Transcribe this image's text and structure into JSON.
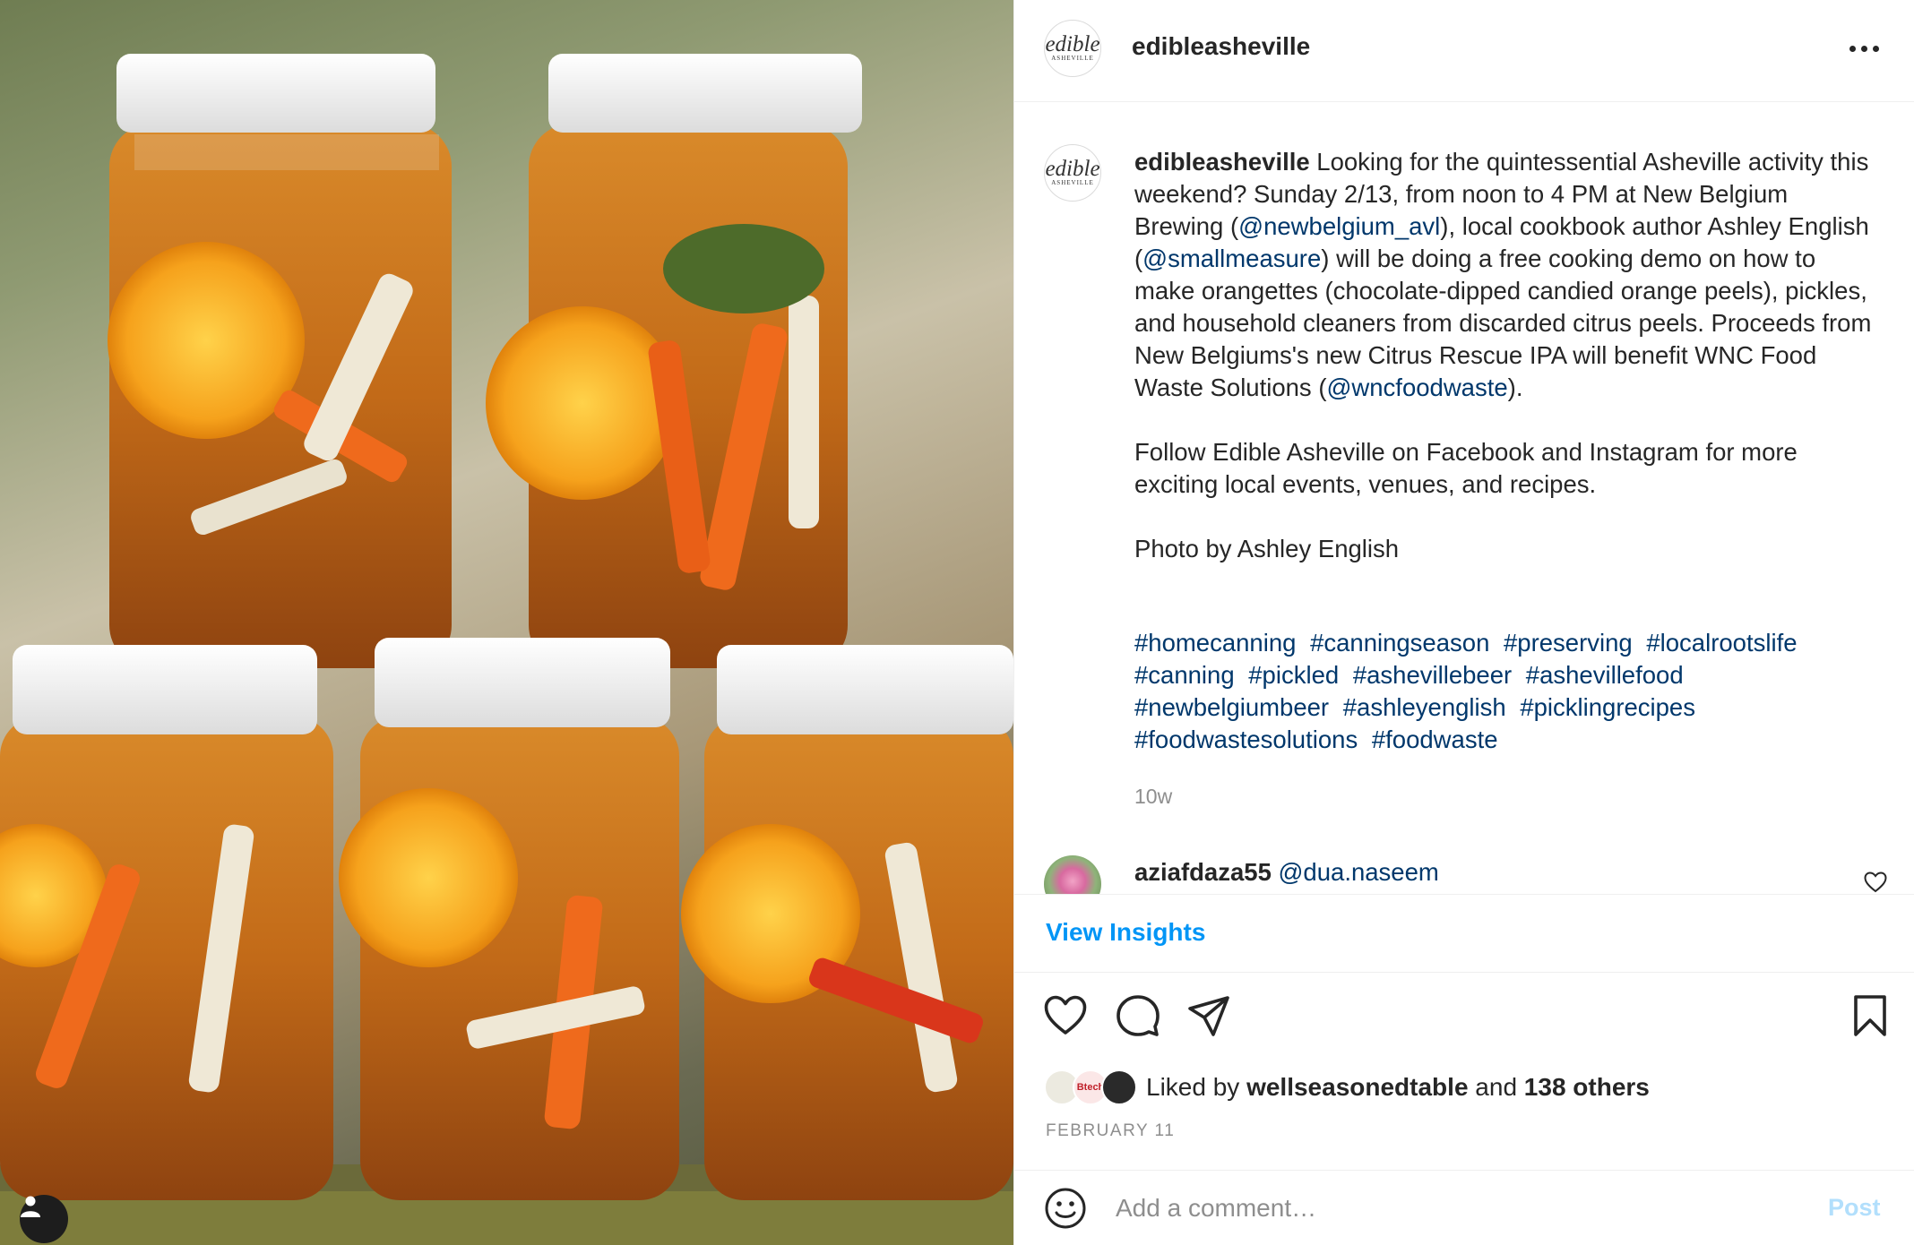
{
  "photo": {
    "alt_subject": "five mason jars of pickled carrots, orange slices and vegetables",
    "user_tag_icon": "person-icon"
  },
  "post": {
    "username": "edibleasheville",
    "avatar_logo_lines": [
      "edible",
      "ASHEVILLE"
    ],
    "more_icon": "more-horizontal-icon",
    "caption": {
      "username": "edibleasheville",
      "segments": [
        " Looking for the quintessential Asheville activity this weekend? Sunday 2/13, from noon to 4 PM at New Belgium Brewing (",
        "@newbelgium_avl",
        "), local cookbook author Ashley English (",
        "@smallmeasure",
        ") will be doing a free cooking demo on how to make orangettes (chocolate-dipped candied orange peels), pickles, and household cleaners from discarded citrus peels. Proceeds from New Belgiums's new Citrus Rescue IPA will benefit WNC Food Waste Solutions (",
        "@wncfoodwaste",
        ").\n\nFollow Edible Asheville on Facebook and Instagram for more exciting local events, venues, and recipes.\n\nPhoto by Ashley English"
      ]
    },
    "hashtags": [
      "#homecanning",
      "#canningseason",
      "#preserving",
      "#localrootslife",
      "#canning",
      "#pickled",
      "#ashevillebeer",
      "#ashevillefood",
      "#newbelgiumbeer",
      "#ashleyenglish",
      "#picklingrecipes",
      "#foodwastesolutions",
      "#foodwaste"
    ],
    "age": "10w",
    "comment": {
      "username": "aziafdaza55",
      "text": "@dua.naseem",
      "like_icon": "heart-outline-icon"
    },
    "insights_label": "View Insights",
    "actions": {
      "like_icon": "heart-icon",
      "comment_icon": "comment-bubble-icon",
      "share_icon": "paper-plane-icon",
      "save_icon": "bookmark-icon"
    },
    "likes": {
      "prefix": "Liked by ",
      "user": "wellseasonedtable",
      "and": " and ",
      "others": "138 others",
      "liker_avatars": [
        "",
        "Btech",
        ""
      ]
    },
    "date": "FEBRUARY 11",
    "comment_input": {
      "emoji_icon": "smiley-icon",
      "placeholder": "Add a comment…",
      "post_label": "Post"
    }
  },
  "colors": {
    "link": "#00376b",
    "accent": "#0095f6",
    "post_disabled": "#b2dffc",
    "muted": "#8e8e8e"
  }
}
